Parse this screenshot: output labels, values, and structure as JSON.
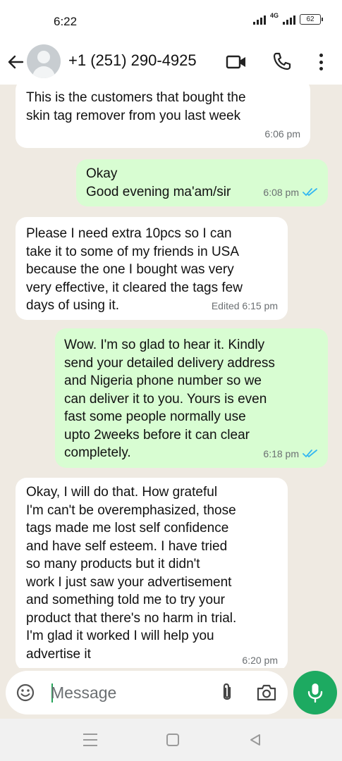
{
  "status_bar": {
    "time": "6:22",
    "network": "4G",
    "battery": "62"
  },
  "header": {
    "contact_name": "+1 (251) 290-4925",
    "icons": [
      "back-arrow-icon",
      "avatar",
      "video-call-icon",
      "phone-call-icon",
      "more-options-icon"
    ]
  },
  "messages": [
    {
      "direction": "incoming",
      "text": "This is the customers that bought the\nskin tag remover from you last week",
      "time": "6:06 pm"
    },
    {
      "direction": "outgoing",
      "text": "Okay\nGood evening ma'am/sir",
      "time": "6:08 pm",
      "status": "read"
    },
    {
      "direction": "incoming",
      "text": "Please I need extra 10pcs so I can\ntake it to some of my friends in USA\nbecause the one I bought was very\nvery effective, it cleared the tags few\ndays of using it.",
      "time": "Edited 6:15 pm"
    },
    {
      "direction": "outgoing",
      "text": "Wow. I'm so glad to hear it. Kindly\nsend your detailed delivery address\nand Nigeria phone number so we\ncan deliver it to you. Yours is even\nfast some people normally use\nupto 2weeks before it can clear\ncompletely.",
      "time": "6:18 pm",
      "status": "read"
    },
    {
      "direction": "incoming",
      "text": "Okay, I will do that. How grateful\nI'm can't be overemphasized, those\ntags made me lost self confidence\nand have self esteem. I have tried\nso many products but it didn't\nwork I just saw your advertisement\nand something told me to try your\nproduct that there's no harm in trial.\nI'm glad it worked I will help you\nadvertise it",
      "time": "6:20 pm"
    }
  ],
  "composer": {
    "placeholder": "Message",
    "icons": [
      "emoji-icon",
      "attach-icon",
      "camera-icon",
      "mic-icon"
    ]
  },
  "colors": {
    "chat_background": "#efeae2",
    "incoming_bubble": "#ffffff",
    "outgoing_bubble": "#d8fdd2",
    "accent_green": "#1daa61",
    "read_ticks": "#34b7f1"
  }
}
